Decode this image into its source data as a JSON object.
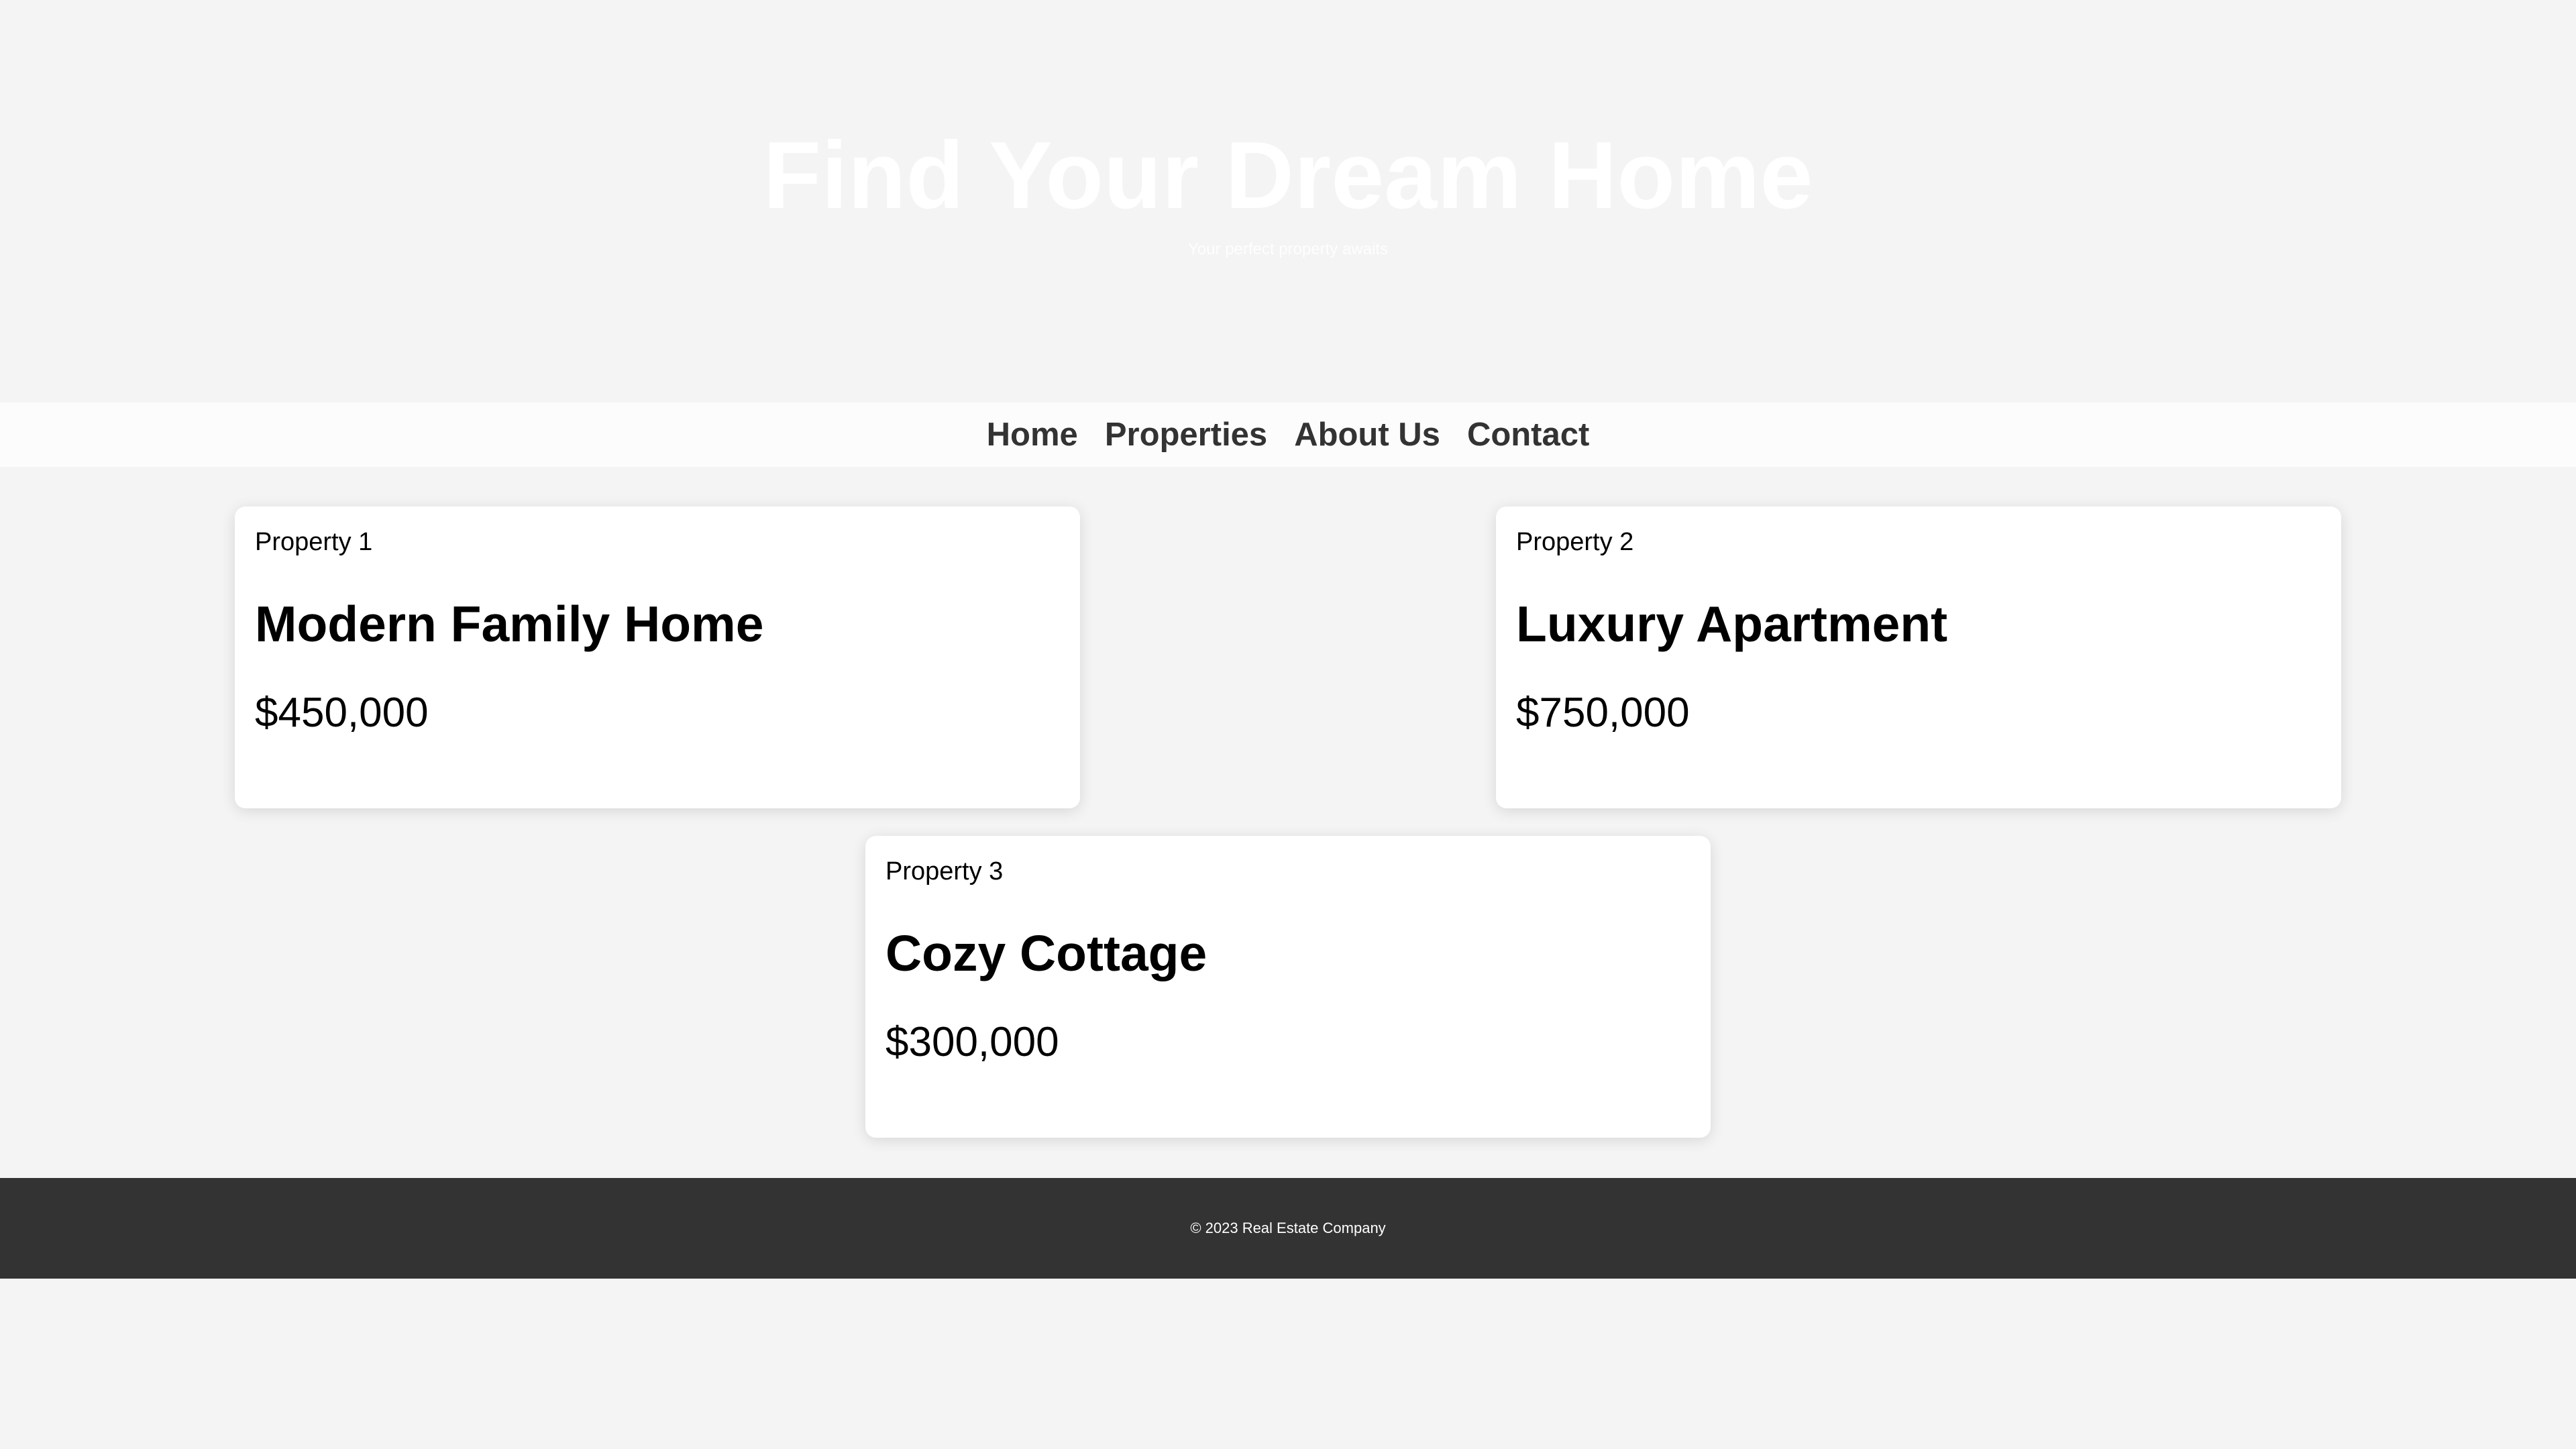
{
  "hero": {
    "title": "Find Your Dream Home",
    "subtitle": "Your perfect property awaits"
  },
  "nav": {
    "items": [
      {
        "label": "Home"
      },
      {
        "label": "Properties"
      },
      {
        "label": "About Us"
      },
      {
        "label": "Contact"
      }
    ]
  },
  "properties": [
    {
      "image_alt": "Property 1",
      "title": "Modern Family Home",
      "price": "$450,000"
    },
    {
      "image_alt": "Property 2",
      "title": "Luxury Apartment",
      "price": "$750,000"
    },
    {
      "image_alt": "Property 3",
      "title": "Cozy Cottage",
      "price": "$300,000"
    }
  ],
  "footer": {
    "copyright": "© 2023 Real Estate Company"
  },
  "colors": {
    "page_background": "#f4f4f4",
    "nav_background": "#fcfcfc",
    "nav_text": "#333333",
    "card_background": "#ffffff",
    "footer_background": "#333333",
    "footer_text": "#ffffff",
    "hero_text": "#ffffff"
  }
}
